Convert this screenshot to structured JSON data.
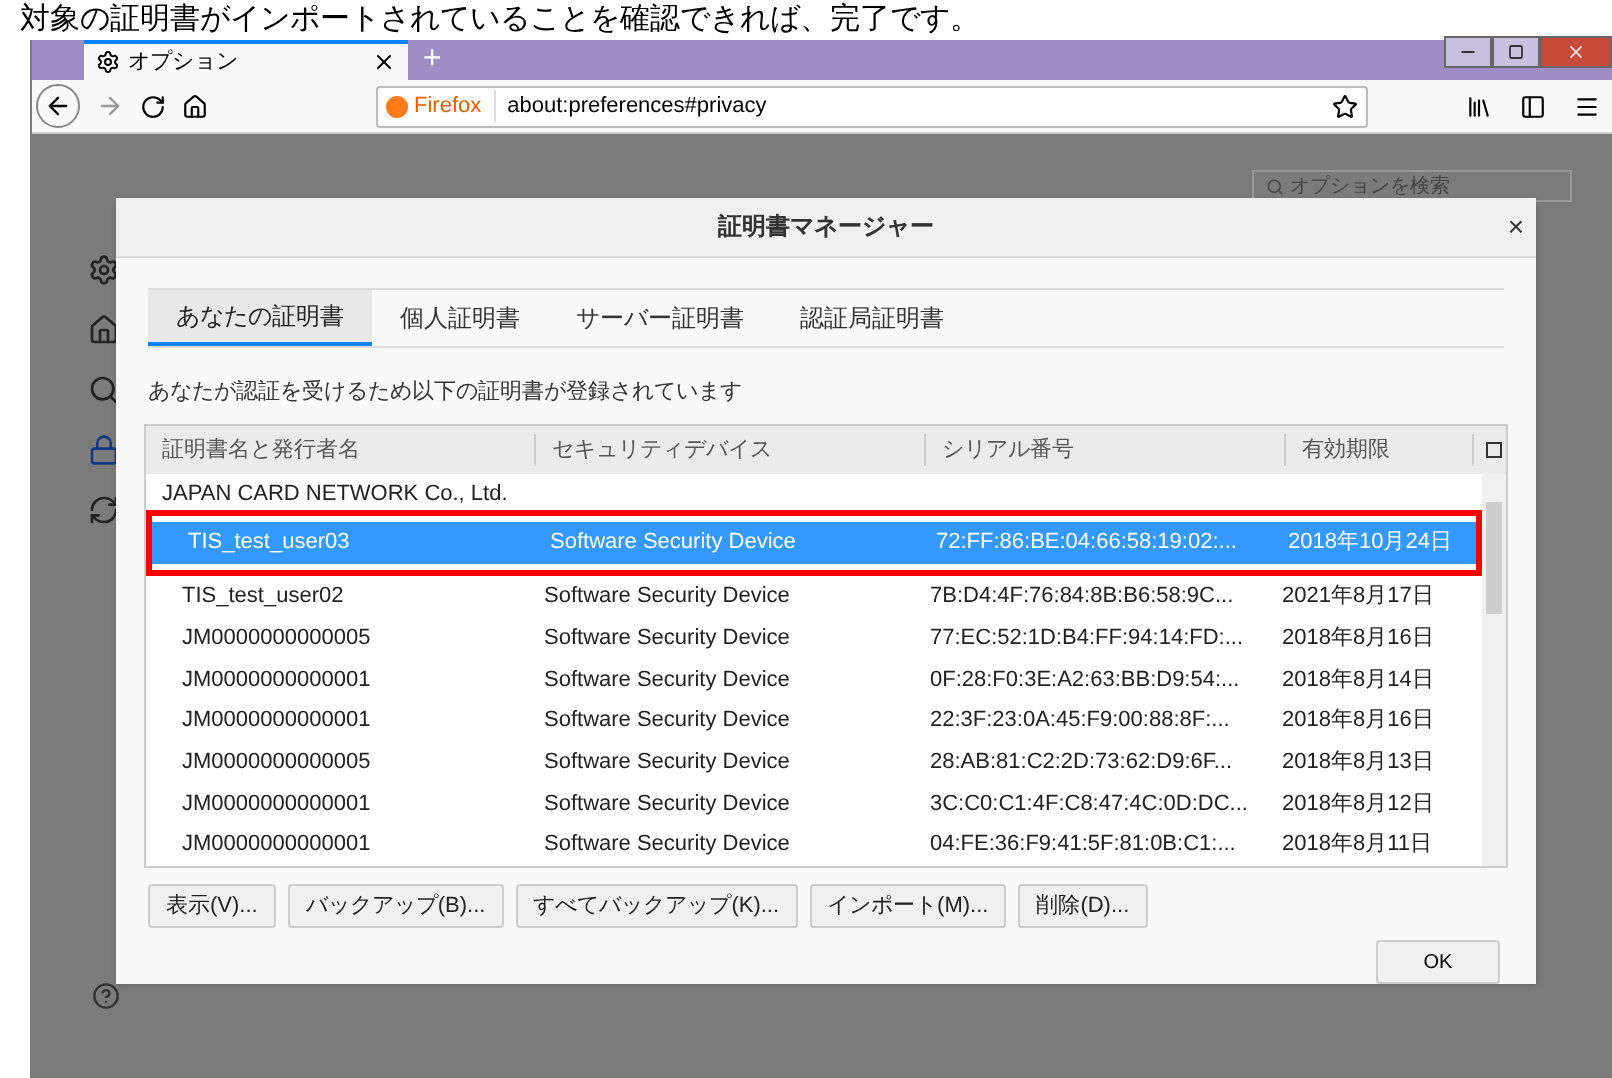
{
  "caption": "対象の証明書がインポートされていることを確認できれば、完了です。",
  "browser": {
    "tab_title": "オプション",
    "new_tab": "+",
    "url_brand": "Firefox",
    "url": "about:preferences#privacy",
    "search_placeholder": "オプションを検索"
  },
  "dialog": {
    "title": "証明書マネージャー",
    "close": "×",
    "tabs": [
      {
        "label": "あなたの証明書",
        "selected": true
      },
      {
        "label": "個人証明書",
        "selected": false
      },
      {
        "label": "サーバー証明書",
        "selected": false
      },
      {
        "label": "認証局証明書",
        "selected": false
      }
    ],
    "description": "あなたが認証を受けるため以下の証明書が登録されています",
    "columns": [
      "証明書名と発行者名",
      "セキュリティデバイス",
      "シリアル番号",
      "有効期限"
    ],
    "group": "JAPAN CARD NETWORK Co., Ltd.",
    "rows": [
      {
        "name": "TIS_test_user03",
        "device": "Software Security Device",
        "serial": "72:FF:86:BE:04:66:58:19:02:...",
        "expiry": "2018年10月24日",
        "selected": true
      },
      {
        "name": "TIS_test_user02",
        "device": "Software Security Device",
        "serial": "7B:D4:4F:76:84:8B:B6:58:9C...",
        "expiry": "2021年8月17日",
        "selected": false
      },
      {
        "name": "JM0000000000005",
        "device": "Software Security Device",
        "serial": "77:EC:52:1D:B4:FF:94:14:FD:...",
        "expiry": "2018年8月16日",
        "selected": false
      },
      {
        "name": "JM0000000000001",
        "device": "Software Security Device",
        "serial": "0F:28:F0:3E:A2:63:BB:D9:54:...",
        "expiry": "2018年8月14日",
        "selected": false
      },
      {
        "name": "JM0000000000001",
        "device": "Software Security Device",
        "serial": "22:3F:23:0A:45:F9:00:88:8F:...",
        "expiry": "2018年8月16日",
        "selected": false
      },
      {
        "name": "JM0000000000005",
        "device": "Software Security Device",
        "serial": "28:AB:81:C2:2D:73:62:D9:6F...",
        "expiry": "2018年8月13日",
        "selected": false
      },
      {
        "name": "JM0000000000001",
        "device": "Software Security Device",
        "serial": "3C:C0:C1:4F:C8:47:4C:0D:DC...",
        "expiry": "2018年8月12日",
        "selected": false
      },
      {
        "name": "JM0000000000001",
        "device": "Software Security Device",
        "serial": "04:FE:36:F9:41:5F:81:0B:C1:...",
        "expiry": "2018年8月11日",
        "selected": false
      }
    ],
    "buttons": [
      "表示(V)...",
      "バックアップ(B)...",
      "すべてバックアップ(K)...",
      "インポート(M)...",
      "削除(D)..."
    ],
    "ok": "OK"
  }
}
